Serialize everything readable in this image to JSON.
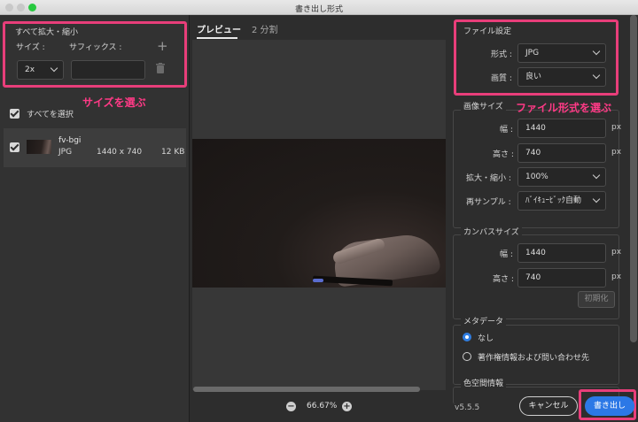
{
  "window": {
    "title": "書き出し形式"
  },
  "left": {
    "scale_all": {
      "heading": "すべて拡大・縮小",
      "size_label": "サイズ :",
      "suffix_label": "サフィックス :",
      "add_icon": "plus-icon",
      "size_value": "2x",
      "suffix_value": "",
      "trash_icon": "trash-icon"
    },
    "annotation_size": "サイズを選ぶ",
    "select_all_label": "すべてを選択",
    "assets": [
      {
        "name": "fv-bgi",
        "format": "JPG",
        "dimensions": "1440 x 740",
        "filesize": "12 KB",
        "checked": true
      }
    ]
  },
  "center": {
    "tabs": [
      {
        "label": "プレビュー",
        "active": true
      },
      {
        "label": "2 分割",
        "active": false
      }
    ],
    "zoom": "66.67%",
    "zoom_out_symbol": "−",
    "zoom_in_symbol": "+"
  },
  "right": {
    "file_settings": {
      "heading": "ファイル設定",
      "format_label": "形式 :",
      "format_value": "JPG",
      "quality_label": "画質 :",
      "quality_value": "良い"
    },
    "annotation_format": "ファイル形式を選ぶ",
    "image_size": {
      "heading": "画像サイズ",
      "width_label": "幅 :",
      "width_value": "1440",
      "height_label": "高さ :",
      "height_value": "740",
      "scale_label": "拡大・縮小 :",
      "scale_value": "100%",
      "resample_label": "再サンプル :",
      "resample_value": "ﾊﾞｲｷｭｰﾋﾞｯｸ自動",
      "unit": "px"
    },
    "canvas_size": {
      "heading": "カンバスサイズ",
      "width_label": "幅 :",
      "width_value": "1440",
      "height_label": "高さ :",
      "height_value": "740",
      "unit": "px",
      "reset_label": "初期化"
    },
    "metadata": {
      "heading": "メタデータ",
      "options": [
        {
          "label": "なし",
          "selected": true
        },
        {
          "label": "著作権情報および問い合わせ先",
          "selected": false
        }
      ]
    },
    "colorspace": {
      "heading": "色空間情報"
    }
  },
  "footer": {
    "version": "v5.5.5",
    "cancel_label": "キャンセル",
    "export_label": "書き出し"
  },
  "colors": {
    "accent": "#2c78e6",
    "annotation": "#e83e7a"
  }
}
